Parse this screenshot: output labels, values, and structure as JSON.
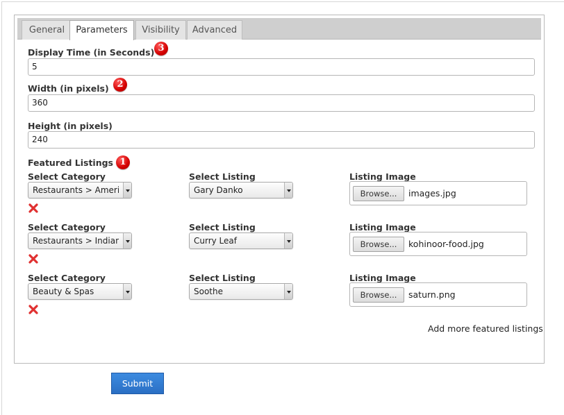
{
  "tabs": [
    {
      "label": "General",
      "active": false
    },
    {
      "label": "Parameters",
      "active": true
    },
    {
      "label": "Visibility",
      "active": false
    },
    {
      "label": "Advanced",
      "active": false
    }
  ],
  "fields": {
    "display_time": {
      "label": "Display Time (in Seconds)",
      "value": "5"
    },
    "width": {
      "label": "Width (in pixels)",
      "value": "360"
    },
    "height": {
      "label": "Height (in pixels)",
      "value": "240"
    }
  },
  "featured": {
    "section_label": "Featured Listings",
    "category_label": "Select Category",
    "listing_label": "Select Listing",
    "image_label": "Listing Image",
    "browse_label": "Browse...",
    "rows": [
      {
        "category": "Restaurants > American",
        "listing": "Gary Danko",
        "image": "images.jpg"
      },
      {
        "category": "Restaurants > Indian",
        "listing": "Curry Leaf",
        "image": "kohinoor-food.jpg"
      },
      {
        "category": "Beauty & Spas",
        "listing": "Soothe",
        "image": "saturn.png"
      }
    ],
    "add_more": "Add more featured listings"
  },
  "badges": {
    "one": "1",
    "two": "2",
    "three": "3"
  },
  "submit_label": "Submit",
  "colors": {
    "badge_red": "#d40000",
    "submit_blue": "#2a6fc4",
    "remove_red": "#e03030"
  }
}
